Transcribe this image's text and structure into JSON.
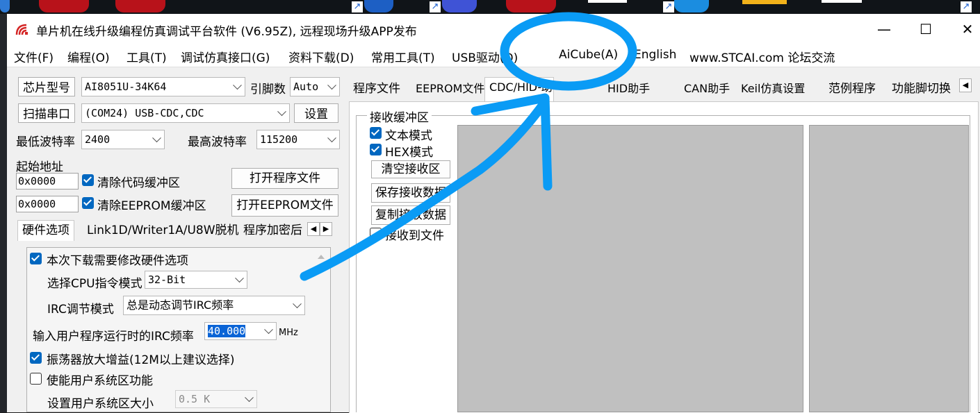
{
  "window": {
    "title": "单片机在线升级编程仿真调试平台软件 (V6.95Z), 远程现场升级APP发布"
  },
  "menu": [
    "文件(F)",
    "编程(O)",
    "工具(T)",
    "调试仿真接口(G)",
    "资料下载(D)",
    "常用工具(T)",
    "USB驱动(D)",
    "AiCube(A)",
    "English",
    "www.STCAI.com 论坛交流"
  ],
  "left": {
    "chip_label": "芯片型号",
    "chip_value": "AI8051U-34K64",
    "pin_label": "引脚数",
    "pin_value": "Auto",
    "scan_label": "扫描串口",
    "port_value": "(COM24) USB-CDC,CDC",
    "settings_label": "设置",
    "min_baud_label": "最低波特率",
    "min_baud_value": "2400",
    "max_baud_label": "最高波特率",
    "max_baud_value": "115200",
    "start_addr_label": "起始地址",
    "addr1": "0x0000",
    "clear_code": "清除代码缓冲区",
    "open_prog": "打开程序文件",
    "addr2": "0x0000",
    "clear_eeprom": "清除EEPROM缓冲区",
    "open_eeprom": "打开EEPROM文件",
    "tabs": [
      "硬件选项",
      "Link1D/Writer1A/U8W脱机",
      "程序加密后"
    ],
    "hw": {
      "modify": "本次下载需要修改硬件选项",
      "cpu_label": "选择CPU指令模式",
      "cpu_value": "32-Bit",
      "irc_label": "IRC调节模式",
      "irc_value": "总是动态调节IRC频率",
      "freq_label": "输入用户程序运行时的IRC频率",
      "freq_value": "40.000",
      "freq_unit": "MHz",
      "osc": "振荡器放大增益(12M以上建议选择)",
      "sys_enable": "使能用户系统区功能",
      "sys_size_label": "设置用户系统区大小",
      "sys_size_value": "0.5 K"
    }
  },
  "right": {
    "tabs": [
      "程序文件",
      "EEPROM文件",
      "CDC/HID-助",
      "HID助手",
      "CAN助手",
      "Keil仿真设置",
      "范例程序",
      "功能脚切换"
    ],
    "recv_title": "接收缓冲区",
    "text_mode": "文本模式",
    "hex_mode": "HEX模式",
    "clear_recv": "清空接收区",
    "save_recv": "保存接收数据",
    "copy_recv": "复制接收数据",
    "recv_to_file": "接收到文件"
  },
  "colors": {
    "annotation": "#0a9bf5",
    "accent": "#0067c0"
  }
}
